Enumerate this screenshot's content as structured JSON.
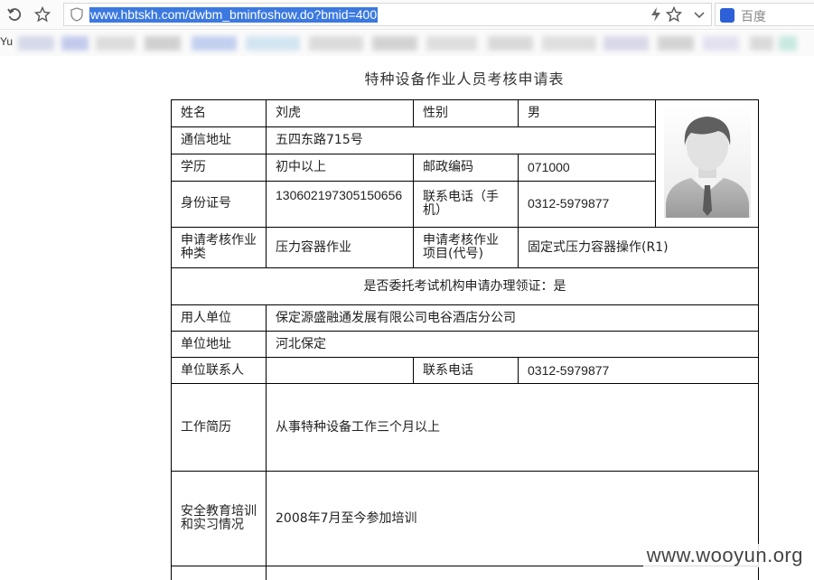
{
  "browser": {
    "url": "www.hbtskh.com/dwbm_bminfoshow.do?bmid=400",
    "search_engine": "百度",
    "bookmark_first": "Yu",
    "accent_color": "#3b79e0"
  },
  "page": {
    "title": "特种设备作业人员考核申请表"
  },
  "form": {
    "name_label": "姓名",
    "name_value": "刘虎",
    "gender_label": "性别",
    "gender_value": "男",
    "address_label": "通信地址",
    "address_value": "五四东路715号",
    "education_label": "学历",
    "education_value": "初中以上",
    "postcode_label": "邮政编码",
    "postcode_value": "071000",
    "id_label": "身份证号",
    "id_value": "130602197305150656",
    "phone_label": "联系电话（手机）",
    "phone_value": "0312-5979877",
    "category_label": "申请考核作业种类",
    "category_value": "压力容器作业",
    "item_label": "申请考核作业项目(代号)",
    "item_value": "固定式压力容器操作(R1)",
    "delegate_text": "是否委托考试机构申请办理领证：是",
    "employer_label": "用人单位",
    "employer_value": "保定源盛融通发展有限公司电谷酒店分公司",
    "employer_addr_label": "单位地址",
    "employer_addr_value": "河北保定",
    "contact_label": "单位联系人",
    "contact_value": "",
    "contact_phone_label": "联系电话",
    "contact_phone_value": "0312-5979877",
    "work_label": "工作简历",
    "work_value": "从事特种设备工作三个月以上",
    "training_label": "安全教育培训和实习情况",
    "training_value": "2008年7月至今参加培训"
  },
  "watermark": "www.wooyun.org"
}
